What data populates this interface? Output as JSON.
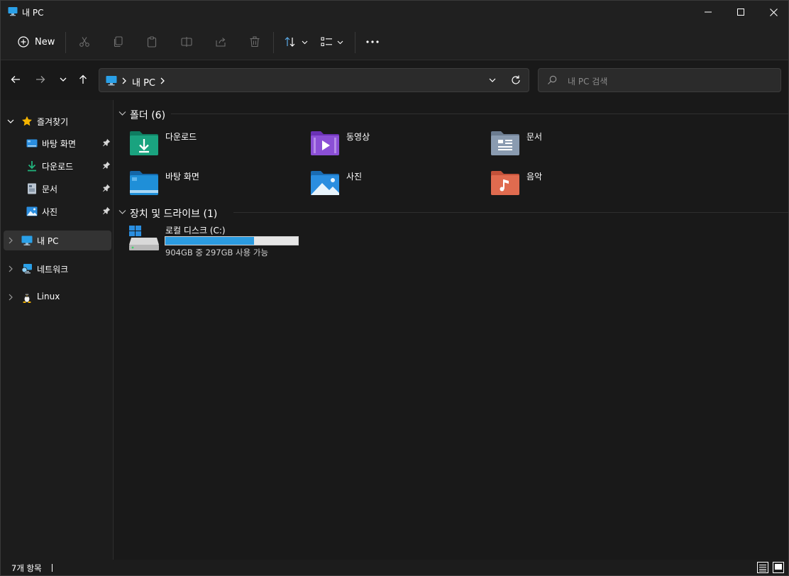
{
  "window": {
    "title": "내 PC"
  },
  "toolbar": {
    "new_label": "New"
  },
  "address": {
    "path": "내 PC"
  },
  "search": {
    "placeholder": "내 PC 검색"
  },
  "sidebar": {
    "favorites": {
      "label": "즐겨찾기",
      "items": [
        {
          "label": "바탕 화면",
          "icon": "desktop-icon"
        },
        {
          "label": "다운로드",
          "icon": "download-icon"
        },
        {
          "label": "문서",
          "icon": "document-icon"
        },
        {
          "label": "사진",
          "icon": "picture-icon"
        }
      ]
    },
    "this_pc": {
      "label": "내 PC"
    },
    "network": {
      "label": "네트워크"
    },
    "linux": {
      "label": "Linux"
    }
  },
  "content": {
    "folders_header": "폴더 (6)",
    "folders": [
      {
        "label": "다운로드",
        "icon": "downloads-folder-icon",
        "color": "#1aa37f"
      },
      {
        "label": "동영상",
        "icon": "videos-folder-icon",
        "color": "#8b4fd6"
      },
      {
        "label": "문서",
        "icon": "documents-folder-icon",
        "color": "#8a9bb0"
      },
      {
        "label": "바탕 화면",
        "icon": "desktop-folder-icon",
        "color": "#1f8fd8"
      },
      {
        "label": "사진",
        "icon": "pictures-folder-icon",
        "color": "#2a8ee0"
      },
      {
        "label": "음악",
        "icon": "music-folder-icon",
        "color": "#e06b4f"
      }
    ],
    "drives_header": "장치 및 드라이브 (1)",
    "drives": [
      {
        "label": "로컬 디스크 (C:)",
        "free_text": "904GB 중 297GB 사용 가능",
        "used_fraction": 0.67,
        "bar_color": "#2b9be0"
      }
    ]
  },
  "status": {
    "item_count": "7개 항목"
  }
}
